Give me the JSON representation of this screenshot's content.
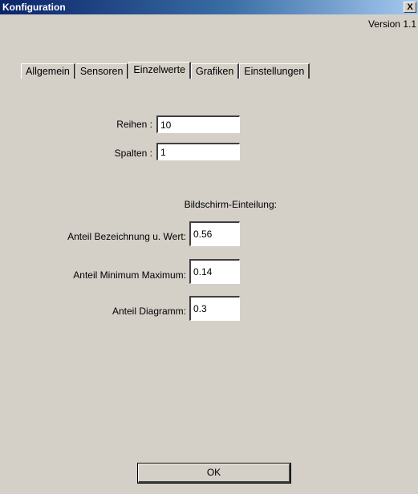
{
  "window": {
    "title": "Konfiguration",
    "close_label": "X",
    "version": "Version 1.1"
  },
  "tabs": [
    {
      "label": "Allgemein",
      "active": false
    },
    {
      "label": "Sensoren",
      "active": false
    },
    {
      "label": "Einzelwerte",
      "active": true
    },
    {
      "label": "Grafiken",
      "active": false
    },
    {
      "label": "Einstellungen",
      "active": false
    }
  ],
  "form": {
    "reihen_label": "Reihen :",
    "reihen_value": "10",
    "spalten_label": "Spalten :",
    "spalten_value": "1",
    "section_heading": "Bildschirm-Einteilung:",
    "anteil_bezeichnung_label": "Anteil Bezeichnung u. Wert:",
    "anteil_bezeichnung_value": "0.56",
    "anteil_minmax_label": "Anteil Minimum Maximum:",
    "anteil_minmax_value": "0.14",
    "anteil_diagramm_label": "Anteil Diagramm:",
    "anteil_diagramm_value": "0.3"
  },
  "footer": {
    "ok_label": "OK"
  }
}
